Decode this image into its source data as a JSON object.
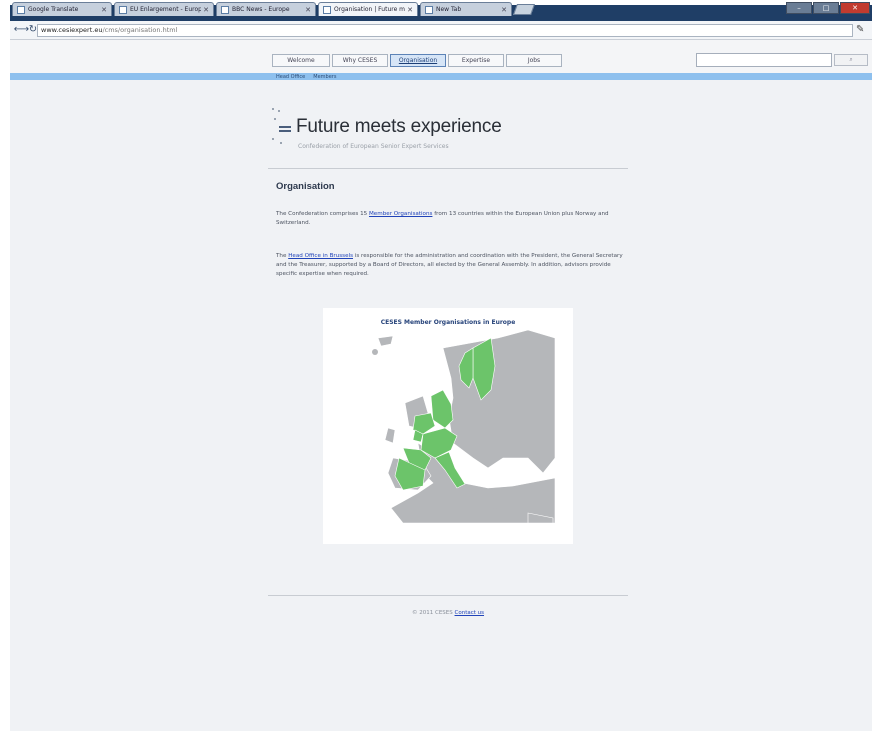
{
  "browser": {
    "tabs": [
      {
        "title": "Google Translate",
        "active": false
      },
      {
        "title": "EU Enlargement - Europa",
        "active": false
      },
      {
        "title": "BBC News - Europe",
        "active": false
      },
      {
        "title": "Organisation | Future me...",
        "active": true
      },
      {
        "title": "New Tab",
        "active": false
      }
    ],
    "address_host": "www.cesiexpert.eu",
    "address_path": "/cms/organisation.html",
    "window_controls": {
      "minimize": "–",
      "maximize": "□",
      "close": "✕"
    }
  },
  "site": {
    "nav": [
      "Welcome",
      "Why CESES",
      "Organisation",
      "Expertise",
      "Jobs"
    ],
    "active_nav": "Organisation",
    "subnav": [
      "Head Office",
      "Members"
    ],
    "title": "Future meets experience",
    "tagline": "Confederation of European Senior Expert Services"
  },
  "content": {
    "heading": "Organisation",
    "p1_pre": "The Confederation comprises 15 ",
    "p1_link": "Member Organisations",
    "p1_post": " from 13 countries within the European Union plus Norway and Switzerland.",
    "p2_pre": "The ",
    "p2_link": "Head Office in Brussels",
    "p2_post": " is responsible for the administration and coordination with the President, the General Secretary and the Treasurer, supported by a Board of Directors, all elected by the General Assembly. In addition, advisors provide specific expertise when required.",
    "map_title": "CESES Member Organisations in Europe"
  },
  "footer": {
    "copyright": "© 2011 CESES",
    "link": "Contact us"
  },
  "colors": {
    "member_country": "#6cc46a",
    "non_member_country": "#b5b7ba",
    "sea": "#ffffff",
    "accent_band": "#8ec0ee"
  }
}
